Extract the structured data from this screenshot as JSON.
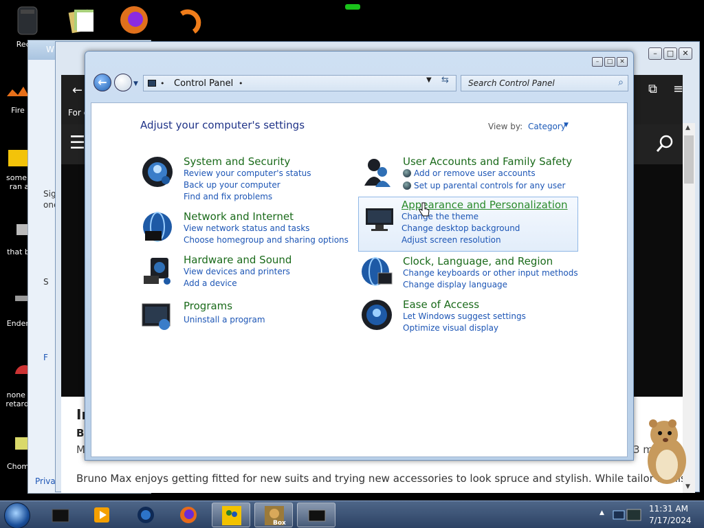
{
  "desktop": {
    "icons": [
      {
        "label": "Recyc",
        "icon": "recycle-bin-icon"
      },
      {
        "label": "Fire",
        "icon": "firefox-shortcut-icon"
      },
      {
        "label": "some r",
        "label2": "ran a",
        "icon": "folder-icon"
      },
      {
        "label": "that bu",
        "icon": "app-icon"
      },
      {
        "label": "Enderr",
        "icon": "app-icon"
      },
      {
        "label": "none c",
        "label2": "retards",
        "icon": "app-icon"
      },
      {
        "label": "Chom",
        "icon": "app-icon"
      }
    ]
  },
  "background_window": {
    "title_fragment": "W",
    "sign_text": "Sig",
    "sign_text2": "one",
    "privacy": "Privac",
    "letter_s": "S",
    "letter_f": "F"
  },
  "browser": {
    "header_fragment": "For c",
    "article_title_fragment": "In",
    "byline_fragment": "Bu",
    "meta_fragment": "M",
    "meta_right": "3 m",
    "snippet": "Bruno Max enjoys getting fitted for new suits and trying new accessories to look spruce and stylish. While tailor Denis"
  },
  "control_panel": {
    "breadcrumb": "Control Panel",
    "search_placeholder": "Search Control Panel",
    "heading": "Adjust your computer's settings",
    "view_by_label": "View by:",
    "view_by_value": "Category",
    "categories_left": [
      {
        "title": "System and Security",
        "icon": "system-security-icon",
        "links": [
          "Review your computer's status",
          "Back up your computer",
          "Find and fix problems"
        ]
      },
      {
        "title": "Network and Internet",
        "icon": "network-internet-icon",
        "links": [
          "View network status and tasks",
          "Choose homegroup and sharing options"
        ]
      },
      {
        "title": "Hardware and Sound",
        "icon": "hardware-sound-icon",
        "links": [
          "View devices and printers",
          "Add a device"
        ]
      },
      {
        "title": "Programs",
        "icon": "programs-icon",
        "links": [
          "Uninstall a program"
        ]
      }
    ],
    "categories_right": [
      {
        "title": "User Accounts and Family Safety",
        "icon": "user-accounts-icon",
        "links": [
          "Add or remove user accounts",
          "Set up parental controls for any user"
        ]
      },
      {
        "title": "Appearance and Personalization",
        "icon": "appearance-icon",
        "links": [
          "Change the theme",
          "Change desktop background",
          "Adjust screen resolution"
        ]
      },
      {
        "title": "Clock, Language, and Region",
        "icon": "clock-language-icon",
        "links": [
          "Change keyboards or other input methods",
          "Change display language"
        ]
      },
      {
        "title": "Ease of Access",
        "icon": "ease-of-access-icon",
        "links": [
          "Let Windows suggest settings",
          "Optimize visual display"
        ]
      }
    ]
  },
  "taskbar": {
    "items": [
      "terminal-icon",
      "media-player-icon",
      "globe-icon",
      "firefox-icon",
      "users-icon",
      "box-game-icon",
      "control-panel-icon"
    ],
    "box_label": "Box",
    "time": "11:31 AM",
    "date": "7/17/2024"
  },
  "colors": {
    "category_title": "#1a6a1a",
    "link": "#1c55b5",
    "heading": "#1e3287"
  }
}
